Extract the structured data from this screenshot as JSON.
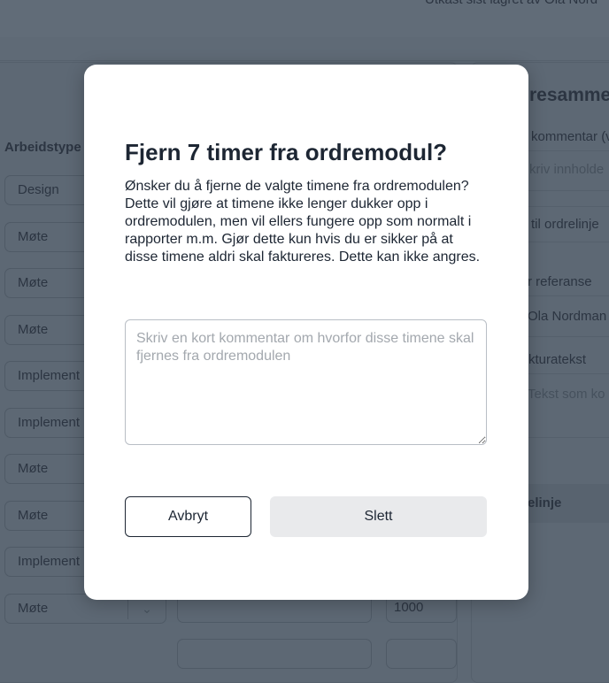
{
  "background": {
    "header_status": "Utkast sist lagret av Ola Nord",
    "column_label": "Arbeidstype",
    "rows": [
      "Design",
      "Møte",
      "Møte",
      "Møte",
      "Implement",
      "Implement",
      "Møte",
      "Møte",
      "Implement",
      "Møte"
    ],
    "last_row_amount": "1000",
    "right_panel": {
      "heading": "resamme",
      "comment_label": "kommentar (v",
      "comment_placeholder": "kriv innholde",
      "link": "til ordrelinje",
      "reference_label": "r referanse",
      "reference_value": "Ola Nordman",
      "invoice_text_label": "kturatekst",
      "invoice_text_placeholder": "Tekst som ko",
      "section": "elinje"
    }
  },
  "modal": {
    "title": "Fjern 7 timer fra ordremodul?",
    "body": "Ønsker du å fjerne de valgte timene fra ordremodulen? Dette vil gjøre at timene ikke lenger dukker opp i ordremodulen, men vil ellers fungere opp som normalt i rapporter m.m. Gjør dette kun hvis du er sikker på at disse timene aldri skal faktureres. Dette kan ikke angres.",
    "comment_placeholder": "Skriv en kort kommentar om hvorfor disse timene skal fjernes fra ordremodulen",
    "comment_value": "",
    "cancel_label": "Avbryt",
    "delete_label": "Slett"
  },
  "colors": {
    "overlay": "#5d6874",
    "title": "#1d2633",
    "delete_button_bg": "#e9eaec"
  }
}
